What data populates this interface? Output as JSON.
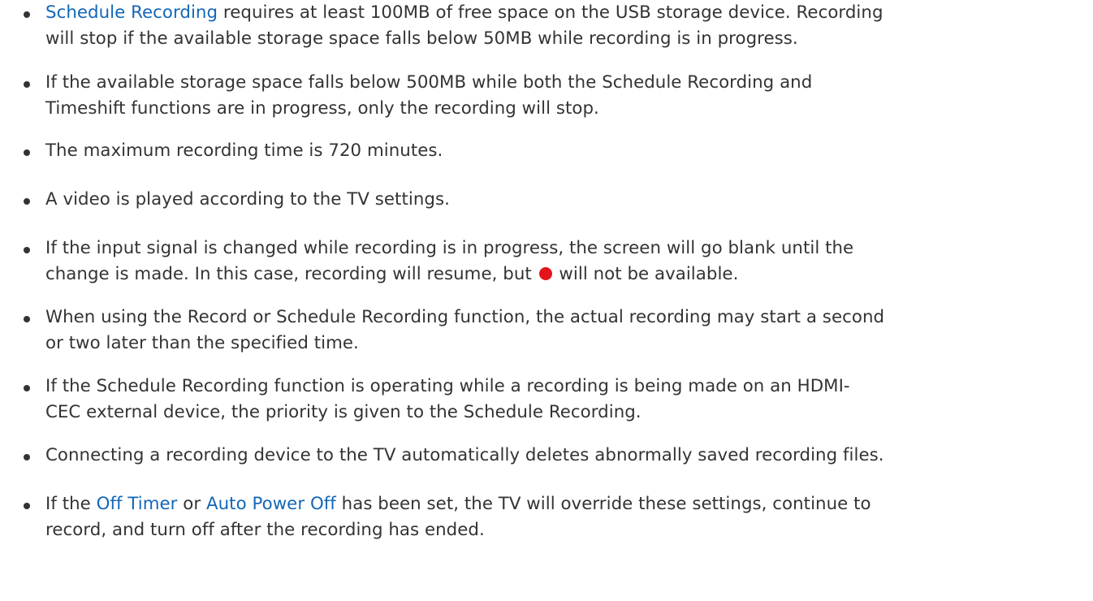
{
  "notes": [
    {
      "line1_kw": "Schedule Recording",
      "line1_rest": " requires at least 100MB of free space on the USB storage device. Recording",
      "line2": "will stop if the available storage space falls below 50MB while recording is in progress."
    },
    {
      "line1": "If the available storage space falls below 500MB while both the Schedule Recording and",
      "line2": "Timeshift functions are in progress, only the recording will stop."
    },
    {
      "line1": "The maximum recording time is 720 minutes."
    },
    {
      "line1": "A video is played according to the TV settings."
    },
    {
      "line1": "If the input signal is changed while recording is in progress, the screen will go blank until the",
      "line2_before": "change is made. In this case, recording will resume, but ",
      "line2_icon": "record-dot-icon",
      "line2_after": " will not be available."
    },
    {
      "line1": "When using the Record or Schedule Recording function, the actual recording may start a second",
      "line2": "or two later than the specified time."
    },
    {
      "line1": "If the Schedule Recording function is operating while a recording is being made on an HDMI-",
      "line2": "CEC external device, the priority is given to the Schedule Recording."
    },
    {
      "line1": "Connecting a recording device to the TV automatically deletes abnormally saved recording files."
    },
    {
      "line1_a": "If the ",
      "line1_kw1": "Off Timer",
      "line1_b": " or ",
      "line1_kw2": "Auto Power Off",
      "line1_c": " has been set, the TV will override these settings, continue to",
      "line2": "record, and turn off after the recording has ended."
    }
  ],
  "colors": {
    "text": "#333333",
    "keyword": "#1367b7",
    "record_dot": "#e4141b"
  }
}
